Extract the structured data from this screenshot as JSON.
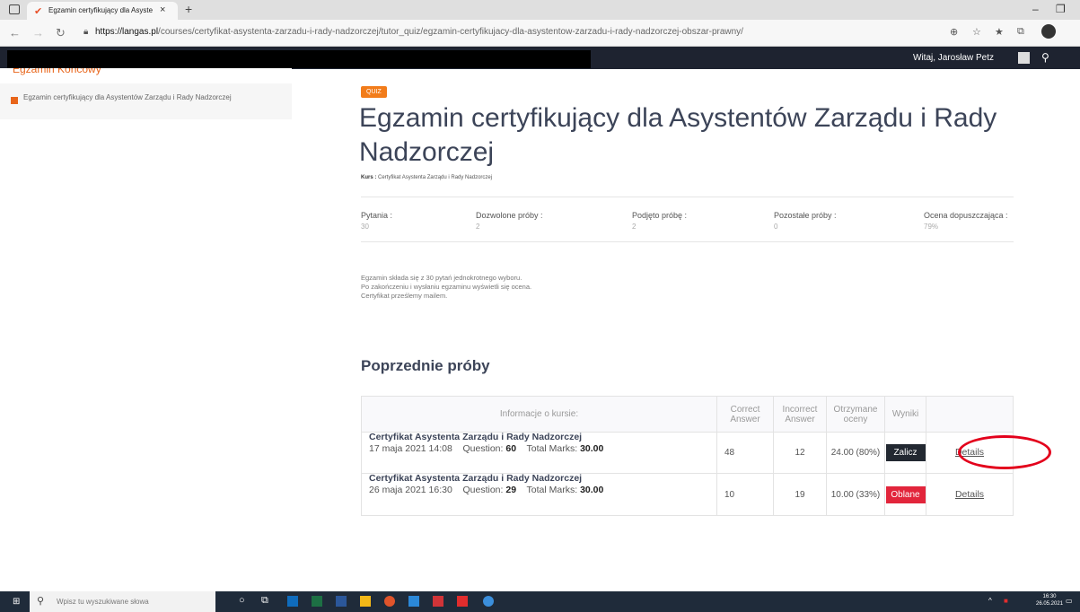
{
  "browser": {
    "tab_title": "Egzamin certyfikujący dla Asyste",
    "tab_close": "×",
    "new_tab": "+",
    "url_host": "https://langas.pl",
    "url_path": "/courses/certyfikat-asystenta-zarzadu-i-rady-nadzorczej/tutor_quiz/egzamin-certyfikujacy-dla-asystentow-zarzadu-i-rady-nadzorczej-obszar-prawny/"
  },
  "site": {
    "sub_header_partial": "Egzamin Końcowy",
    "welcome": "Witaj, Jarosław Petz"
  },
  "sidebar": {
    "item_label": "Egzamin certyfikujący dla Asystentów Zarządu i Rady Nadzorczej"
  },
  "quiz": {
    "badge": "QUIZ",
    "title": "Egzamin certyfikujący dla Asystentów Zarządu i Rady Nadzorczej",
    "course_label": "Kurs :",
    "course_name": "Certyfikat Asystenta Zarządu i Rady Nadzorczej",
    "stats": [
      {
        "label": "Pytania :",
        "value": "30"
      },
      {
        "label": "Dozwolone próby :",
        "value": "2"
      },
      {
        "label": "Podjęto próbę :",
        "value": "2"
      },
      {
        "label": "Pozostałe próby :",
        "value": "0"
      },
      {
        "label": "Ocena dopuszczająca :",
        "value": "79%"
      }
    ],
    "description": [
      "Egzamin składa się z 30 pytań jednokrotnego wyboru.",
      "Po zakończeniu i wysłaniu egzaminu wyświetli się ocena.",
      "Certyfikat prześlemy mailem."
    ]
  },
  "attempts": {
    "heading": "Poprzednie próby",
    "columns": [
      "Informacje o kursie:",
      "Correct Answer",
      "Incorrect Answer",
      "Otrzymane oceny",
      "Wyniki",
      ""
    ],
    "question_label": "Question:",
    "total_label": "Total Marks:",
    "rows": [
      {
        "course": "Certyfikat Asystenta Zarządu i Rady Nadzorczej",
        "date": "17 maja 2021 14:08",
        "questions": "60",
        "total": "30.00",
        "correct": "48",
        "incorrect": "12",
        "grade": "24.00 (80%)",
        "result": "Zalicz",
        "details": "Details"
      },
      {
        "course": "Certyfikat Asystenta Zarządu i Rady Nadzorczej",
        "date": "26 maja 2021 16:30",
        "questions": "29",
        "total": "30.00",
        "correct": "10",
        "incorrect": "19",
        "grade": "10.00 (33%)",
        "result": "Oblane",
        "details": "Details"
      }
    ]
  },
  "taskbar": {
    "search_placeholder": "Wpisz tu wyszukiwane słowa",
    "time": "16:30",
    "date": "26.05.2021"
  },
  "colors": {
    "accent": "#f27c1a",
    "pass": "#222831",
    "fail": "#e2253b",
    "highlight_ring": "#e3001b"
  }
}
